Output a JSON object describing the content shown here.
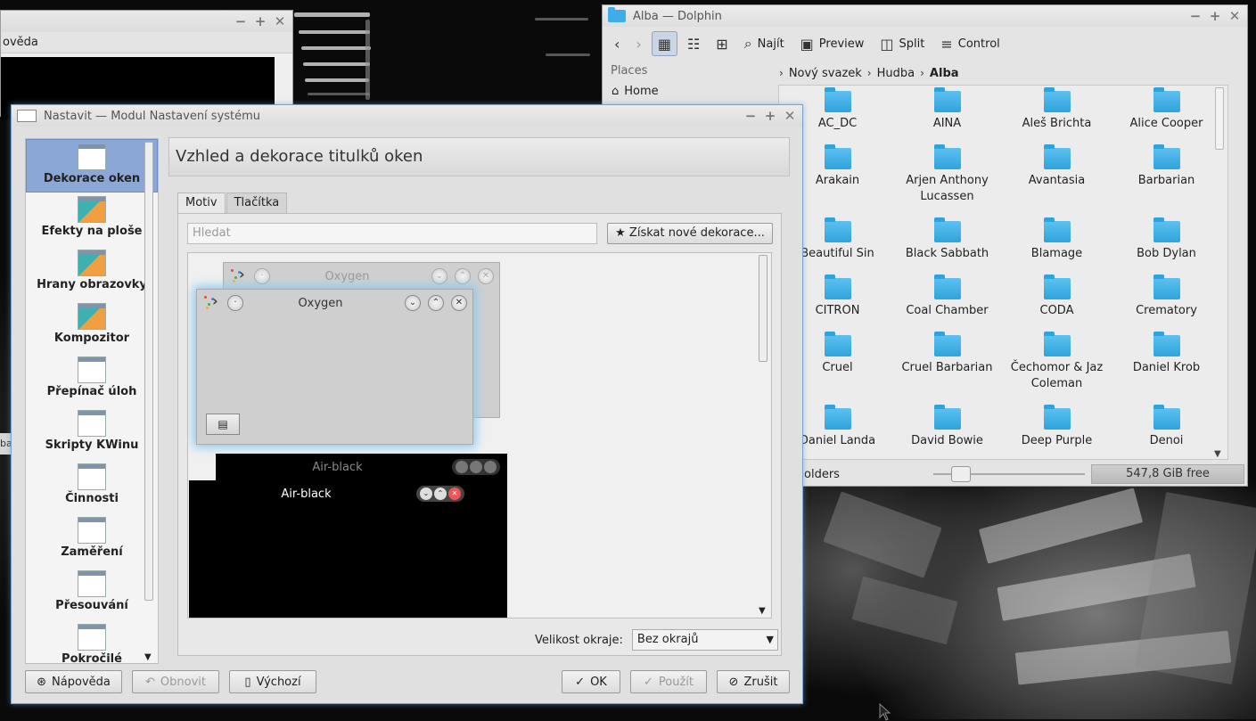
{
  "background_window": {
    "menu_visible_text": "ovědа",
    "edge_text": "ba"
  },
  "dolphin": {
    "title": "Alba — Dolphin",
    "toolbar": {
      "find": "Najít",
      "preview": "Preview",
      "split": "Split",
      "control": "Control"
    },
    "places": {
      "label": "Places",
      "items": [
        "Home"
      ]
    },
    "breadcrumb": [
      "Nový svazek",
      "Hudba",
      "Alba"
    ],
    "folders": [
      "AC_DC",
      "AINA",
      "Aleš Brichta",
      "Alice Cooper",
      "Arakain",
      "Arjen Anthony Lucassen",
      "Avantasia",
      "Barbarian",
      "Beautiful Sin",
      "Black Sabbath",
      "Blamage",
      "Bob Dylan",
      "CITRON",
      "Coal Chamber",
      "CODA",
      "Crematory",
      "Cruel",
      "Cruel Barbarian",
      "Čechomor & Jaz Coleman",
      "Daniel Krob",
      "Daniel Landa",
      "David Bowie",
      "Deep Purple",
      "Denoi"
    ],
    "status": {
      "left_text": "olders",
      "free_space": "547,8 GiB free"
    }
  },
  "settings": {
    "title": "Nastavit — Modul Nastavení systému",
    "sidebar": [
      {
        "label": "Dekorace oken",
        "selected": true
      },
      {
        "label": "Efekty na ploše"
      },
      {
        "label": "Hrany obrazovky"
      },
      {
        "label": "Kompozitor"
      },
      {
        "label": "Přepínač úloh"
      },
      {
        "label": "Skripty KWinu"
      },
      {
        "label": "Činnosti"
      },
      {
        "label": "Zaměření"
      },
      {
        "label": "Přesouvání"
      },
      {
        "label": "Pokročilé"
      }
    ],
    "header_title": "Vzhled a dekorace titulků oken",
    "tabs": [
      "Motiv",
      "Tlačítka"
    ],
    "search_placeholder": "Hledat",
    "get_new_button": "Získat nové dekorace...",
    "previews": {
      "oxygen_back": "Oxygen",
      "oxygen_front": "Oxygen",
      "air_back": "Air-black",
      "air_front": "Air-black"
    },
    "border_size_label": "Velikost okraje:",
    "border_size_value": "Bez okrajů",
    "buttons": {
      "help": "Nápověda",
      "reset": "Obnovit",
      "defaults": "Výchozí",
      "ok": "OK",
      "apply": "Použít",
      "cancel": "Zrušit"
    }
  },
  "colors": {
    "selection": "#8aa7d6",
    "folder": "#3daee9",
    "glow": "#8ccaf0"
  }
}
